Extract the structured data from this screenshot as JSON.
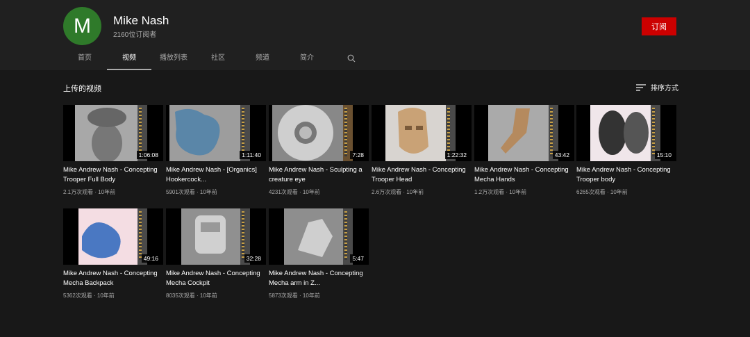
{
  "channel": {
    "avatar_letter": "M",
    "name": "Mike Nash",
    "subscribers": "2160位订阅者",
    "subscribe_label": "订阅"
  },
  "tabs": [
    {
      "label": "首页"
    },
    {
      "label": "视频"
    },
    {
      "label": "播放列表"
    },
    {
      "label": "社区"
    },
    {
      "label": "频道"
    },
    {
      "label": "简介"
    }
  ],
  "section": {
    "title": "上传的视频",
    "sort_label": "排序方式"
  },
  "videos": [
    {
      "title": "Mike Andrew Nash - Concepting Trooper Full Body",
      "duration": "1:06:08",
      "views": "2.1万次观看",
      "age": "10年前",
      "icon": "sculpt-figure-back"
    },
    {
      "title": "Mike Andrew Nash - [Organics] Hookercock...",
      "duration": "1:11:40",
      "views": "5901次观看",
      "age": "10年前",
      "icon": "sculpt-blue-organic"
    },
    {
      "title": "Mike Andrew Nash - Sculpting a creature eye",
      "duration": "7:28",
      "views": "4231次观看",
      "age": "10年前",
      "icon": "sculpt-eye"
    },
    {
      "title": "Mike Andrew Nash - Concepting Trooper Head",
      "duration": "1:22:32",
      "views": "2.6万次观看",
      "age": "10年前",
      "icon": "sculpt-head"
    },
    {
      "title": "Mike Andrew Nash - Concepting Mecha Hands",
      "duration": "43:42",
      "views": "1.2万次观看",
      "age": "10年前",
      "icon": "sculpt-hand"
    },
    {
      "title": "Mike Andrew Nash - Concepting Trooper body",
      "duration": "15:10",
      "views": "6265次观看",
      "age": "10年前",
      "icon": "sculpt-bodies"
    },
    {
      "title": "Mike Andrew Nash - Concepting Mecha Backpack",
      "duration": "49:16",
      "views": "5362次观看",
      "age": "10年前",
      "icon": "sculpt-backpack"
    },
    {
      "title": "Mike Andrew Nash - Concepting Mecha Cockpit",
      "duration": "32:28",
      "views": "8035次观看",
      "age": "10年前",
      "icon": "sculpt-cockpit"
    },
    {
      "title": "Mike Andrew Nash - Concepting Mecha arm in Z...",
      "duration": "5:47",
      "views": "5873次观看",
      "age": "10年前",
      "icon": "sculpt-arm"
    }
  ],
  "colors": {
    "background": "#181818",
    "header": "#202020",
    "subscribe": "#cc0000",
    "avatar": "#2f7a2a"
  }
}
